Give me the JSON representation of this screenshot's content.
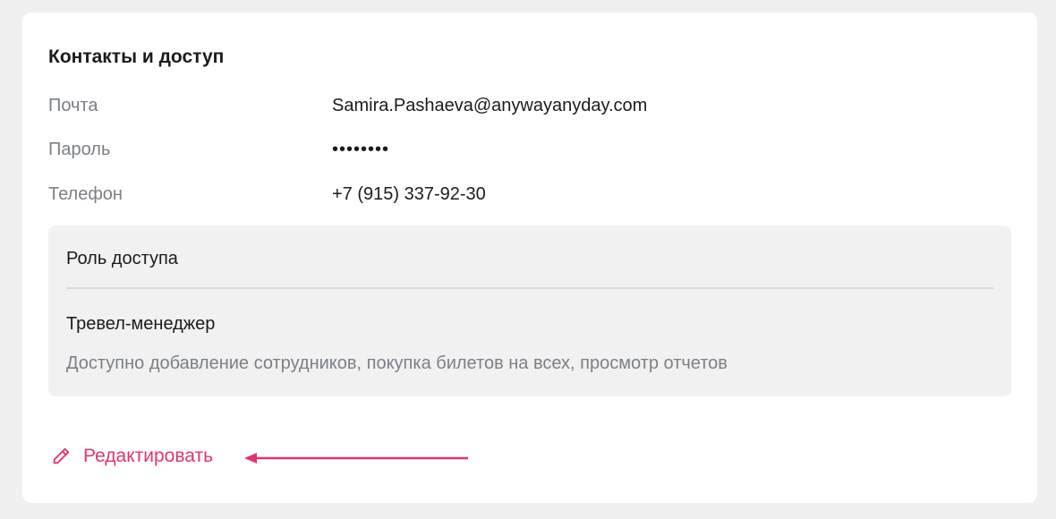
{
  "section": {
    "title": "Контакты и доступ"
  },
  "contacts": {
    "email_label": "Почта",
    "email_value": "Samira.Pashaeva@anywayanyday.com",
    "password_label": "Пароль",
    "password_value": "••••••••",
    "phone_label": "Телефон",
    "phone_value": "+7 (915) 337-92-30"
  },
  "access": {
    "heading": "Роль доступа",
    "role_name": "Тревел-менеджер",
    "role_description": "Доступно добавление сотрудников, покупка билетов на всех, просмотр отчетов"
  },
  "actions": {
    "edit_label": "Редактировать",
    "edit_icon": "pencil-icon"
  },
  "colors": {
    "accent": "#e0356f",
    "muted_text": "#7b8086",
    "role_box_bg": "#f1f1f1"
  }
}
